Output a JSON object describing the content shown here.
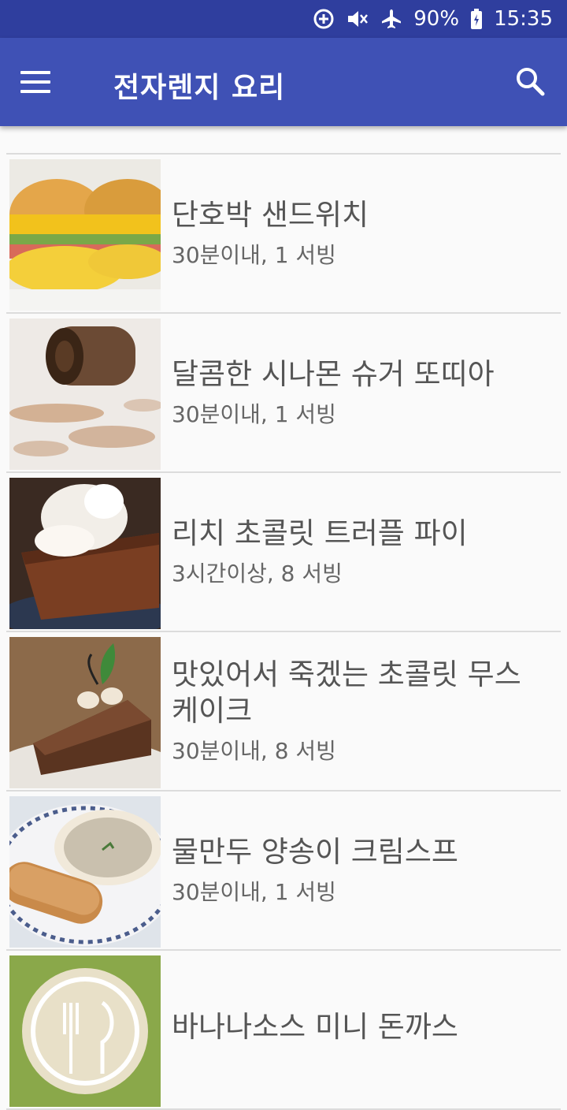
{
  "status_bar": {
    "battery": "90%",
    "time": "15:35"
  },
  "app_bar": {
    "title": "전자렌지 요리"
  },
  "recipes": [
    {
      "title": "단호박 샌드위치",
      "meta": "30분이내, 1 서빙"
    },
    {
      "title": "달콤한 시나몬 슈거 또띠아",
      "meta": "30분이내, 1 서빙"
    },
    {
      "title": "리치 초콜릿 트러플 파이",
      "meta": "3시간이상, 8 서빙"
    },
    {
      "title": "맛있어서 죽겠는 초콜릿 무스 케이크",
      "meta": "30분이내, 8 서빙"
    },
    {
      "title": "물만두 양송이 크림스프",
      "meta": "30분이내, 1 서빙"
    },
    {
      "title": "바나나소스 미니 돈까스",
      "meta": ""
    }
  ]
}
